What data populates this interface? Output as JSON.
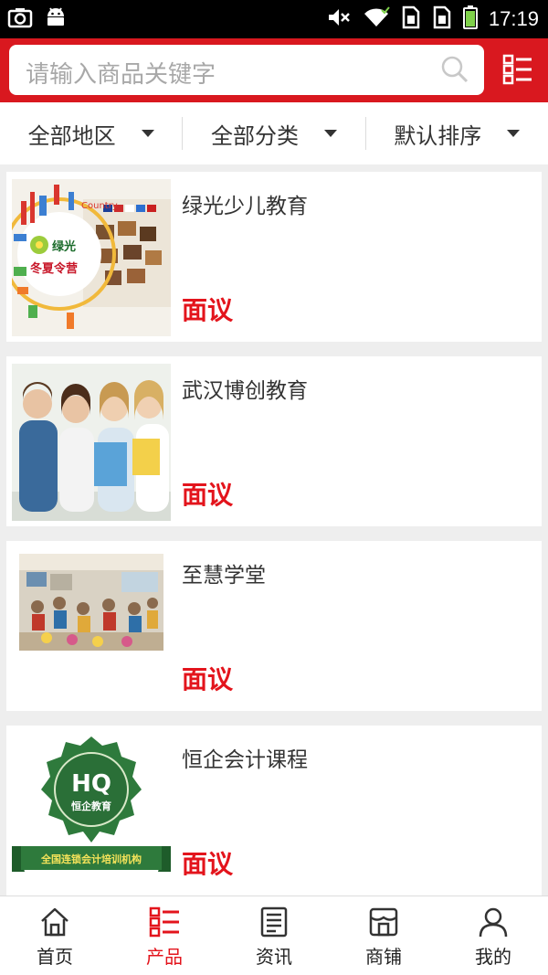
{
  "status_bar": {
    "time": "17:19",
    "icons": [
      "camera-icon",
      "android-icon",
      "mute-icon",
      "wifi-icon",
      "sim1-icon",
      "sim2-icon",
      "battery-icon"
    ]
  },
  "search": {
    "placeholder": "请输入商品关键字",
    "icon": "search-icon",
    "menu_icon": "grid-menu-icon"
  },
  "filters": [
    {
      "label": "全部地区"
    },
    {
      "label": "全部分类"
    },
    {
      "label": "默认排序"
    }
  ],
  "products": [
    {
      "name": "绿光少儿教育",
      "price": "面议",
      "logo_text": "绿光",
      "logo_sub": "冬夏令营",
      "banner_word": "Country"
    },
    {
      "name": "武汉博创教育",
      "price": "面议"
    },
    {
      "name": "至慧学堂",
      "price": "面议"
    },
    {
      "name": "恒企会计课程",
      "price": "面议",
      "logo_text": "HQ",
      "logo_sub": "恒企教育",
      "ribbon_text": "全国连锁会计培训机构"
    }
  ],
  "nav": [
    {
      "label": "首页",
      "icon": "home-icon"
    },
    {
      "label": "产品",
      "icon": "product-list-icon"
    },
    {
      "label": "资讯",
      "icon": "news-icon"
    },
    {
      "label": "商铺",
      "icon": "store-icon"
    },
    {
      "label": "我的",
      "icon": "user-icon"
    }
  ],
  "colors": {
    "brand": "#d9181f",
    "price": "#e3141c",
    "active_nav": "#e3141c"
  }
}
